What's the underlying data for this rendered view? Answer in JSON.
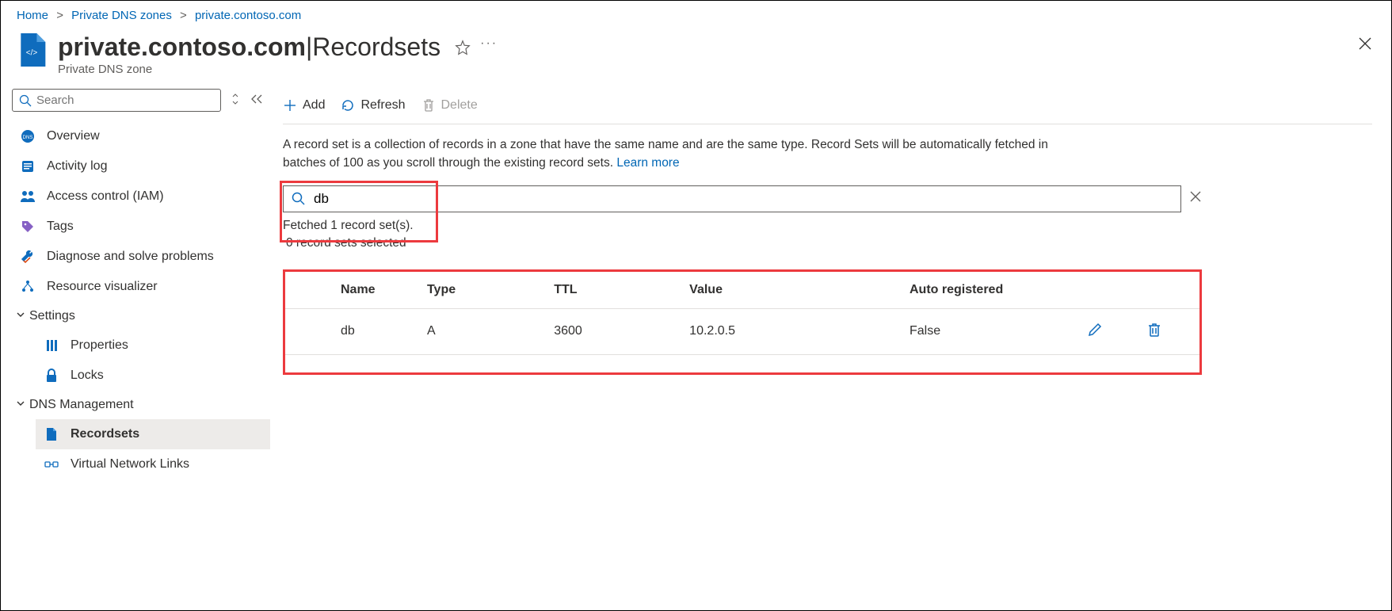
{
  "breadcrumb": {
    "items": [
      "Home",
      "Private DNS zones",
      "private.contoso.com"
    ]
  },
  "header": {
    "title_main": "private.contoso.com",
    "title_sep": " | ",
    "title_section": "Recordsets",
    "subtitle": "Private DNS zone"
  },
  "sidebar": {
    "search_placeholder": "Search",
    "items": [
      {
        "label": "Overview"
      },
      {
        "label": "Activity log"
      },
      {
        "label": "Access control (IAM)"
      },
      {
        "label": "Tags"
      },
      {
        "label": "Diagnose and solve problems"
      },
      {
        "label": "Resource visualizer"
      }
    ],
    "group_settings": {
      "label": "Settings",
      "items": [
        {
          "label": "Properties"
        },
        {
          "label": "Locks"
        }
      ]
    },
    "group_dns": {
      "label": "DNS Management",
      "items": [
        {
          "label": "Recordsets",
          "active": true
        },
        {
          "label": "Virtual Network Links"
        }
      ]
    }
  },
  "toolbar": {
    "add": "Add",
    "refresh": "Refresh",
    "delete": "Delete"
  },
  "description": {
    "text": "A record set is a collection of records in a zone that have the same name and are the same type. Record Sets will be automatically fetched in batches of 100 as you scroll through the existing record sets. ",
    "learn_more": "Learn more"
  },
  "record_search": {
    "value": "db",
    "fetched_status": "Fetched 1 record set(s).",
    "selected_status": "0 record sets selected"
  },
  "table": {
    "headers": {
      "name": "Name",
      "type": "Type",
      "ttl": "TTL",
      "value": "Value",
      "auto": "Auto registered"
    },
    "rows": [
      {
        "name": "db",
        "type": "A",
        "ttl": "3600",
        "value": "10.2.0.5",
        "auto": "False"
      }
    ]
  }
}
